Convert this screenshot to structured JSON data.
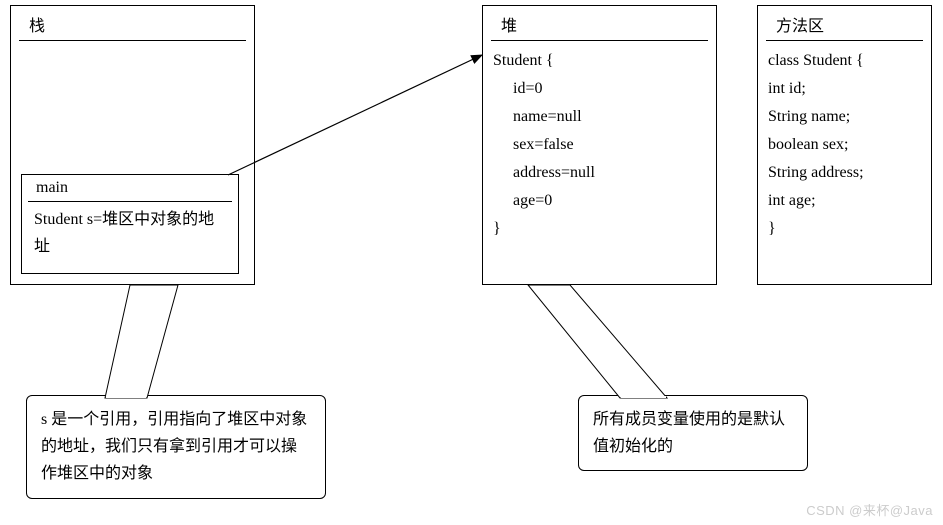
{
  "stack": {
    "title": "栈",
    "main": {
      "title": "main",
      "body": "Student s=堆区中对象的地址"
    }
  },
  "heap": {
    "title": "堆",
    "lines": [
      "Student {",
      "id=0",
      "name=null",
      "sex=false",
      "address=null",
      "age=0",
      "}"
    ]
  },
  "method_area": {
    "title": "方法区",
    "lines": [
      "class Student {",
      "int id;",
      "String name;",
      "boolean sex;",
      "String address;",
      "int age;",
      "}"
    ]
  },
  "callout_left": "s 是一个引用，引用指向了堆区中对象的地址，我们只有拿到引用才可以操作堆区中的对象",
  "callout_right": "所有成员变量使用的是默认值初始化的",
  "watermark": "CSDN @来杯@Java"
}
